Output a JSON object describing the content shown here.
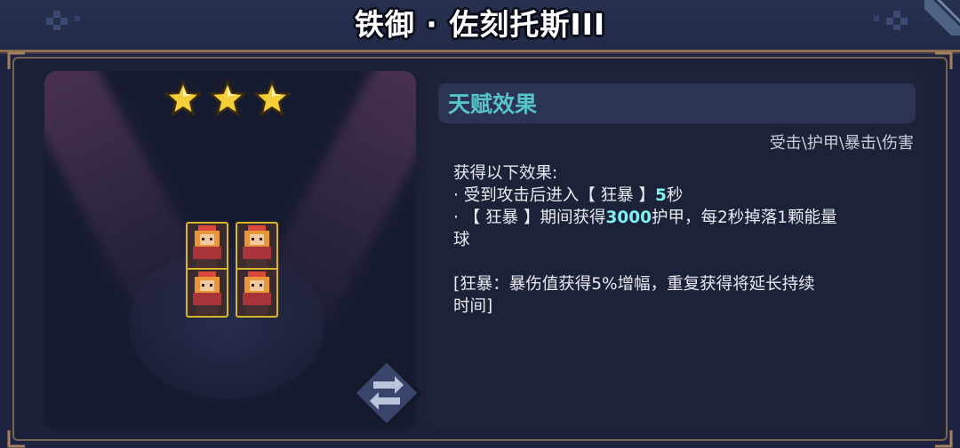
{
  "title": "铁御 · 佐刻托斯III",
  "hero": {
    "stars": 3,
    "unit_count": 4
  },
  "talent": {
    "header": "天赋效果",
    "tags": "受击\\护甲\\暴击\\伤害",
    "intro": "获得以下效果:",
    "line1_prefix": "· 受到攻击后进入【 狂暴 】",
    "line1_value": "5",
    "line1_suffix": "秒",
    "line2_prefix": "· 【 狂暴 】期间获得",
    "line2_value": "3000",
    "line2_suffix": "护甲，每2秒掉落1颗能量",
    "line2_wrap": "球",
    "note_line1": "[狂暴：暴伤值获得5%增幅，重复获得将延长持续",
    "note_line2": "时间]"
  },
  "colors": {
    "background": "#1d2340",
    "title_border": "#8a6e4e",
    "accent_teal": "#56c3c8",
    "highlight": "#7df2f0",
    "star_gold": "#f4cf3a",
    "unit_border": "#d9b52a"
  },
  "icons": {
    "star": "star-icon",
    "swap": "swap-icon"
  }
}
